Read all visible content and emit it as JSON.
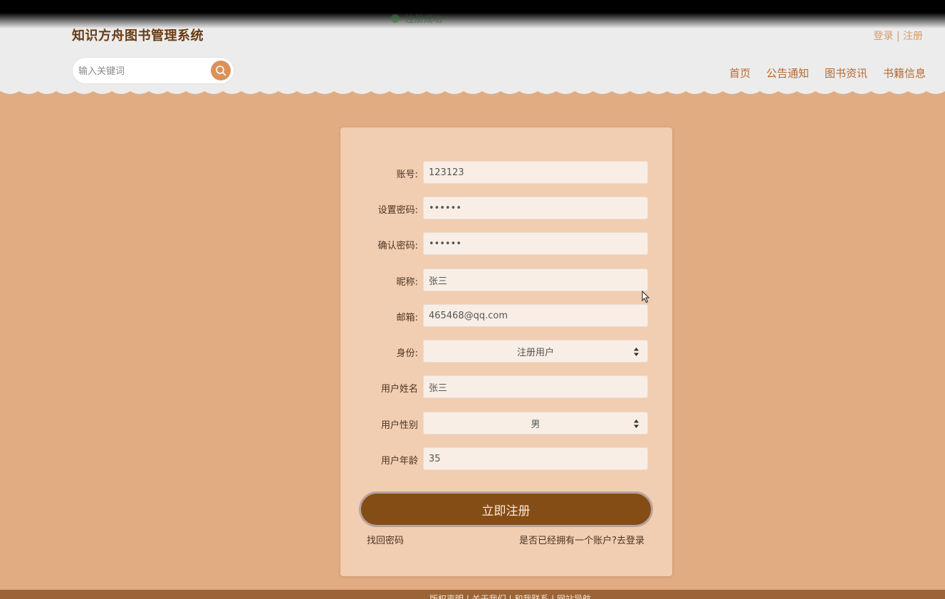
{
  "toast": {
    "text": "注册成功"
  },
  "header": {
    "brand": "知识方舟图书管理系统",
    "auth": {
      "login": "登录",
      "separator": " | ",
      "register": "注册"
    },
    "search": {
      "placeholder": "输入关键词",
      "icon": "search-icon"
    },
    "nav": [
      "首页",
      "公告通知",
      "图书资讯",
      "书籍信息"
    ]
  },
  "form": {
    "fields": [
      {
        "label": "账号:",
        "value": "123123",
        "type": "text"
      },
      {
        "label": "设置密码:",
        "value": "••••••",
        "type": "password"
      },
      {
        "label": "确认密码:",
        "value": "••••••",
        "type": "password"
      },
      {
        "label": "昵称:",
        "value": "张三",
        "type": "text"
      },
      {
        "label": "邮箱:",
        "value": "465468@qq.com",
        "type": "text"
      },
      {
        "label": "身份:",
        "value": "注册用户",
        "type": "select"
      },
      {
        "label": "用户姓名",
        "value": "张三",
        "type": "text"
      },
      {
        "label": "用户性别",
        "value": "男",
        "type": "select"
      },
      {
        "label": "用户年龄",
        "value": "35",
        "type": "text"
      }
    ],
    "submit_label": "立即注册",
    "forgot_label": "找回密码",
    "have_account_prefix": "是否已经拥有一个账户?",
    "go_login_label": "去登录"
  },
  "footer": {
    "text": "版权声明 | 关于我们 | 和我联系 | 网站导航"
  },
  "colors": {
    "accent": "#d9925a",
    "primary_button": "#854d16",
    "background": "#e1ac82",
    "card": "#f1cdb1"
  }
}
